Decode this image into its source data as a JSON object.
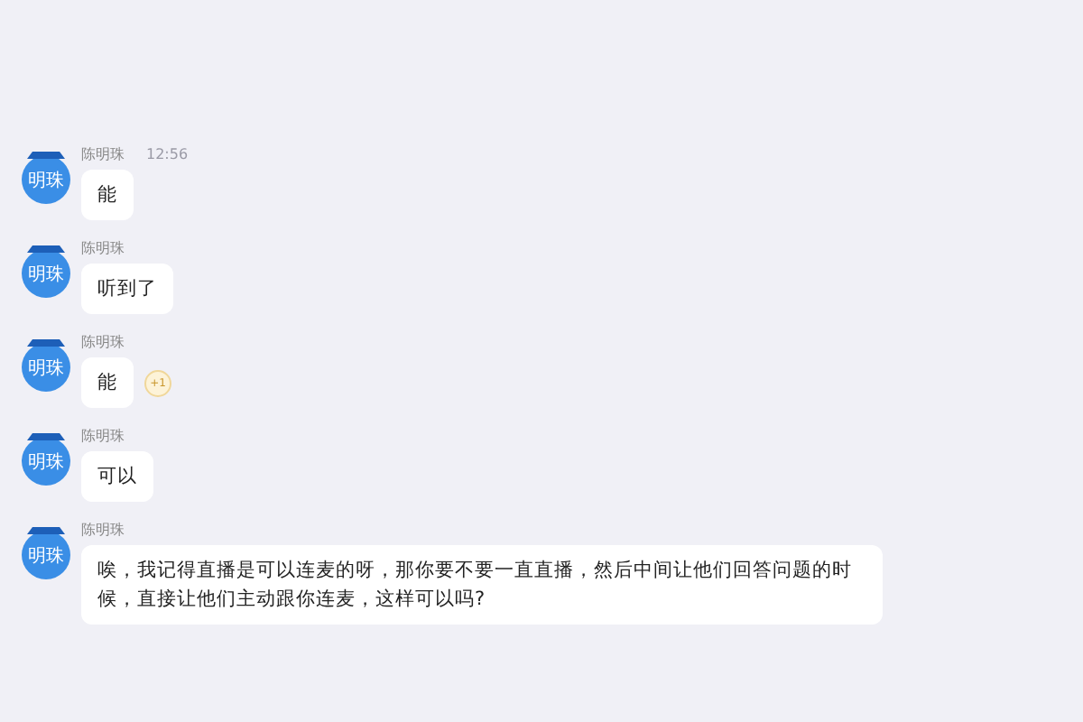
{
  "messages": [
    {
      "sender": "陈明珠",
      "avatar_text": "明珠",
      "time": "12:56",
      "text": "能"
    },
    {
      "sender": "陈明珠",
      "avatar_text": "明珠",
      "text": "听到了"
    },
    {
      "sender": "陈明珠",
      "avatar_text": "明珠",
      "text": "能",
      "reaction": "+1"
    },
    {
      "sender": "陈明珠",
      "avatar_text": "明珠",
      "text": "可以"
    },
    {
      "sender": "陈明珠",
      "avatar_text": "明珠",
      "text": "唉，我记得直播是可以连麦的呀，那你要不要一直直播，然后中间让他们回答问题的时候，直接让他们主动跟你连麦，这样可以吗?"
    }
  ]
}
